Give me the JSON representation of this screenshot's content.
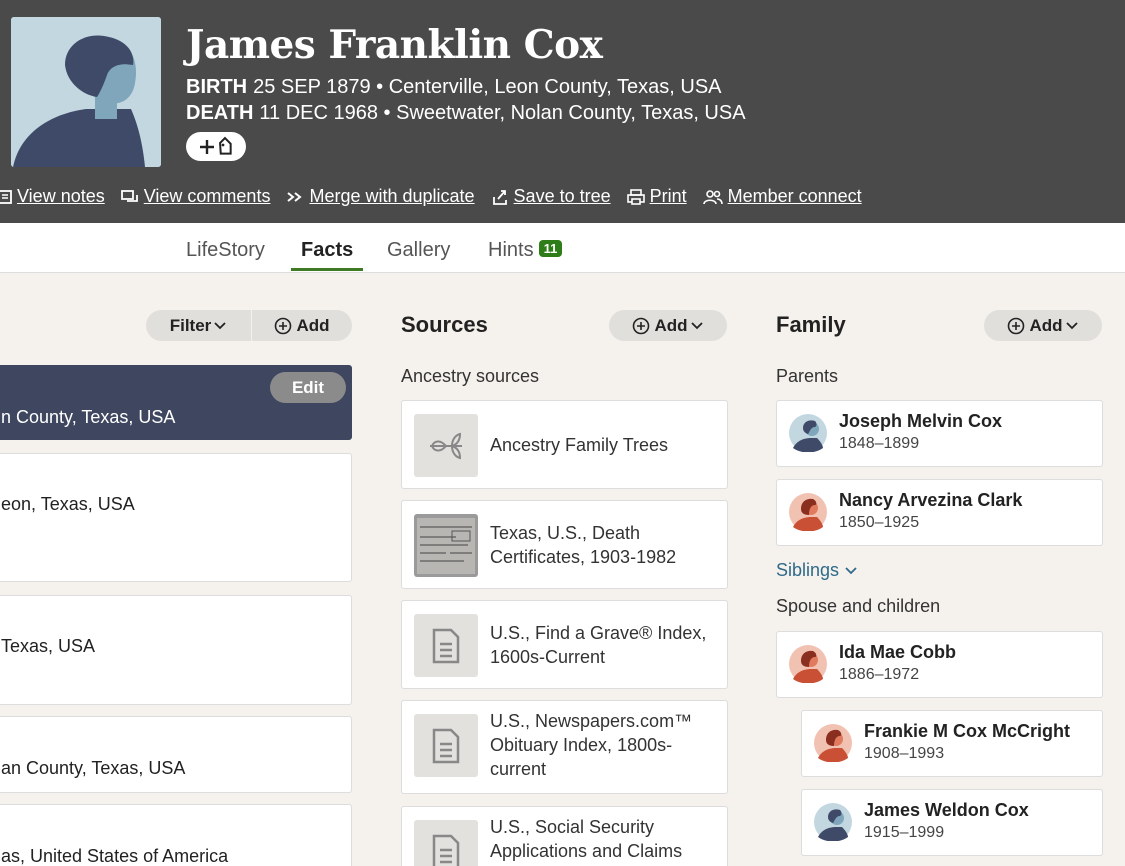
{
  "person": {
    "name": "James Franklin Cox",
    "birth_label": "BIRTH",
    "birth_value": "25 SEP 1879 • Centerville, Leon County, Texas, USA",
    "death_label": "DEATH",
    "death_value": "11 DEC 1968 • Sweetwater, Nolan County, Texas, USA"
  },
  "actions": [
    {
      "label": "View notes",
      "icon": "notes-icon"
    },
    {
      "label": "View comments",
      "icon": "comments-icon"
    },
    {
      "label": "Merge with duplicate",
      "icon": "merge-icon"
    },
    {
      "label": "Save to tree",
      "icon": "save-icon"
    },
    {
      "label": "Print",
      "icon": "print-icon"
    },
    {
      "label": "Member connect",
      "icon": "members-icon"
    }
  ],
  "tabs": [
    {
      "label": "LifeStory"
    },
    {
      "label": "Facts"
    },
    {
      "label": "Gallery"
    },
    {
      "label": "Hints",
      "badge": "11"
    }
  ],
  "facts": {
    "filter_label": "Filter",
    "add_label": "Add",
    "edit_label": "Edit",
    "items": [
      "n County, Texas, USA",
      "eon, Texas, USA",
      " Texas, USA",
      "an County, Texas, USA",
      "as, United States of America"
    ]
  },
  "sources": {
    "title": "Sources",
    "add_label": "Add",
    "subhead": "Ancestry sources",
    "items": [
      {
        "label": "Ancestry Family Trees",
        "icon": "leaf-icon"
      },
      {
        "label": "Texas, U.S., Death Certificates, 1903-1982",
        "icon": "document-image-icon"
      },
      {
        "label": "U.S., Find a Grave® Index, 1600s-Current",
        "icon": "document-icon"
      },
      {
        "label": "U.S., Newspapers.com™ Obituary Index, 1800s-current",
        "icon": "document-icon"
      },
      {
        "label": "U.S., Social Security Applications and Claims",
        "icon": "document-icon"
      }
    ]
  },
  "family": {
    "title": "Family",
    "add_label": "Add",
    "parents_label": "Parents",
    "siblings_label": "Siblings",
    "spouse_label": "Spouse and children",
    "parents": [
      {
        "name": "Joseph Melvin Cox",
        "years": "1848–1899",
        "gender": "male"
      },
      {
        "name": "Nancy Arvezina Clark",
        "years": "1850–1925",
        "gender": "female"
      }
    ],
    "spouse": {
      "name": "Ida Mae Cobb",
      "years": "1886–1972",
      "gender": "female"
    },
    "children": [
      {
        "name": "Frankie M Cox McCright",
        "years": "1908–1993",
        "gender": "female"
      },
      {
        "name": "James Weldon Cox",
        "years": "1915–1999",
        "gender": "male"
      }
    ]
  },
  "colors": {
    "header_bg": "#4a4a4a",
    "selected_card": "#3f4760",
    "tab_accent": "#3d7a23",
    "link": "#2f6a8a"
  }
}
